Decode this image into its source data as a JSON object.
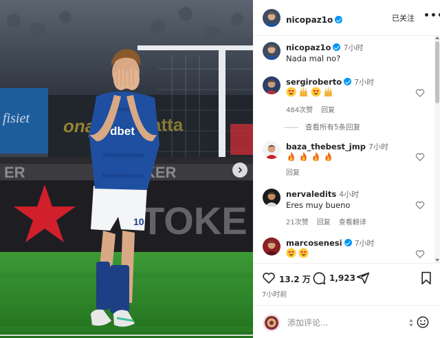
{
  "post": {
    "author": "nicopaz1o",
    "follow_state": "已关注",
    "more_label": "•••",
    "likes": "13.2 万",
    "comments_count": "1,923",
    "posted": "7小时前",
    "jersey_sponsor": "dbet",
    "jersey_number": "10",
    "banner_text_1": "ER",
    "banner_text_2": "KER",
    "banner_text_3": "TOKE"
  },
  "comments": [
    {
      "user": "nicopaz1o",
      "verified": true,
      "time": "7小时",
      "text": "Nada mal no?",
      "likes": "",
      "reply": "",
      "translate": ""
    },
    {
      "user": "sergiroberto",
      "verified": true,
      "time": "7小时",
      "emojis": [
        "heart-eyes",
        "raised-hands",
        "heart-eyes",
        "raised-hands"
      ],
      "likes": "484次赞",
      "reply": "回复",
      "view_replies": "查看所有5条回复"
    },
    {
      "user": "baza_thebest_jmp",
      "verified": false,
      "time": "7小时",
      "emojis": [
        "fire",
        "fire",
        "fire",
        "fire"
      ],
      "reply": "回复"
    },
    {
      "user": "nervaledits",
      "verified": false,
      "time": "4小时",
      "text": "Eres muy bueno",
      "likes": "21次赞",
      "reply": "回复",
      "translate": "查看翻译"
    },
    {
      "user": "marcosenesi",
      "verified": true,
      "time": "7小时",
      "emojis": [
        "heart-eyes",
        "heart-eyes"
      ]
    }
  ],
  "composer": {
    "placeholder": "添加评论..."
  },
  "icons": {
    "like": "heart-icon",
    "comment": "comment-bubble-icon",
    "share": "send-icon",
    "save": "bookmark-icon",
    "emoji": "smiley-icon",
    "next": "chevron-right-icon"
  },
  "colors": {
    "verified": "#0095f6",
    "pitch": "#2f8a2d",
    "jersey": "#1f4fa0"
  }
}
